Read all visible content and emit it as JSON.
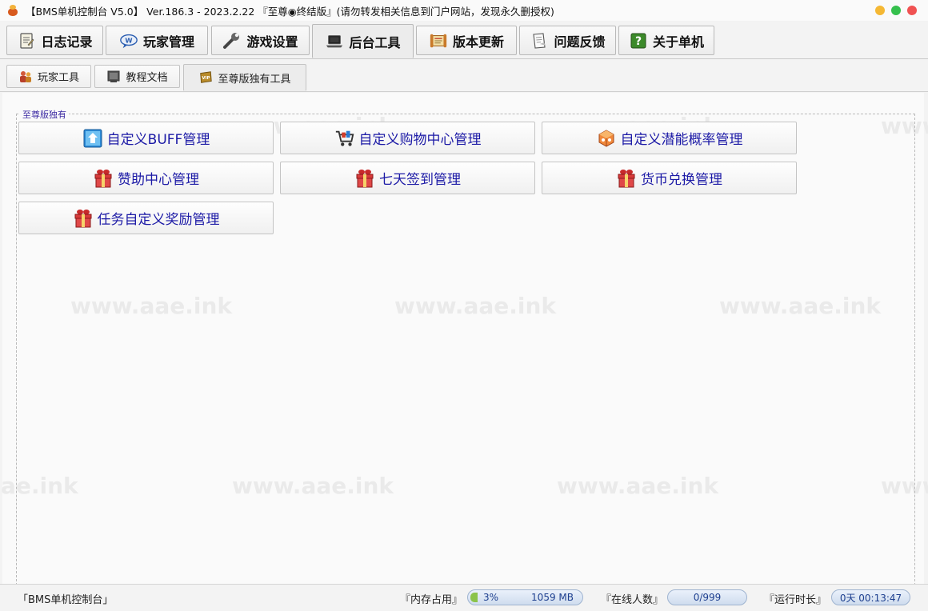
{
  "window": {
    "title": "【BMS单机控制台 V5.0】 Ver.186.3 - 2023.2.22 『至尊◉终结版』(请勿转发相关信息到门户网站，发现永久删授权)",
    "colors": {
      "min": "#f5b834",
      "max": "#35c04d",
      "close": "#f05252"
    }
  },
  "main_tabs": [
    {
      "label": "日志记录",
      "icon": "notepad-icon"
    },
    {
      "label": "玩家管理",
      "icon": "chat-bubble-icon"
    },
    {
      "label": "游戏设置",
      "icon": "wrench-icon"
    },
    {
      "label": "后台工具",
      "icon": "laptop-icon",
      "active": true
    },
    {
      "label": "版本更新",
      "icon": "scroll-icon"
    },
    {
      "label": "问题反馈",
      "icon": "feedback-note-icon"
    },
    {
      "label": "关于单机",
      "icon": "question-icon"
    }
  ],
  "sub_tabs": [
    {
      "label": "玩家工具",
      "icon": "players-icon"
    },
    {
      "label": "教程文档",
      "icon": "document-icon"
    },
    {
      "label": "至尊版独有工具",
      "icon": "vip-badge-icon",
      "active": true
    }
  ],
  "group": {
    "label": "至尊版独有",
    "buttons": [
      {
        "label": "自定义BUFF管理",
        "icon": "buff-icon"
      },
      {
        "label": "自定义购物中心管理",
        "icon": "shopping-cart-icon"
      },
      {
        "label": "自定义潜能概率管理",
        "icon": "cube-icon"
      },
      {
        "label": "赞助中心管理",
        "icon": "gift-icon"
      },
      {
        "label": "七天签到管理",
        "icon": "gift-icon"
      },
      {
        "label": "货币兑换管理",
        "icon": "gift-icon"
      },
      {
        "label": "任务自定义奖励管理",
        "icon": "gift-icon"
      }
    ]
  },
  "watermark": "www.aae.ink",
  "watermark_partial": "ae.ink",
  "status": {
    "app": "「BMS单机控制台」",
    "memory_label": "『内存占用』",
    "memory_percent": "3%",
    "memory_used": "1059 MB",
    "online_label": "『在线人数』",
    "online_value": "0/999",
    "runtime_label": "『运行时长』",
    "runtime_value": "0天 00:13:47"
  }
}
